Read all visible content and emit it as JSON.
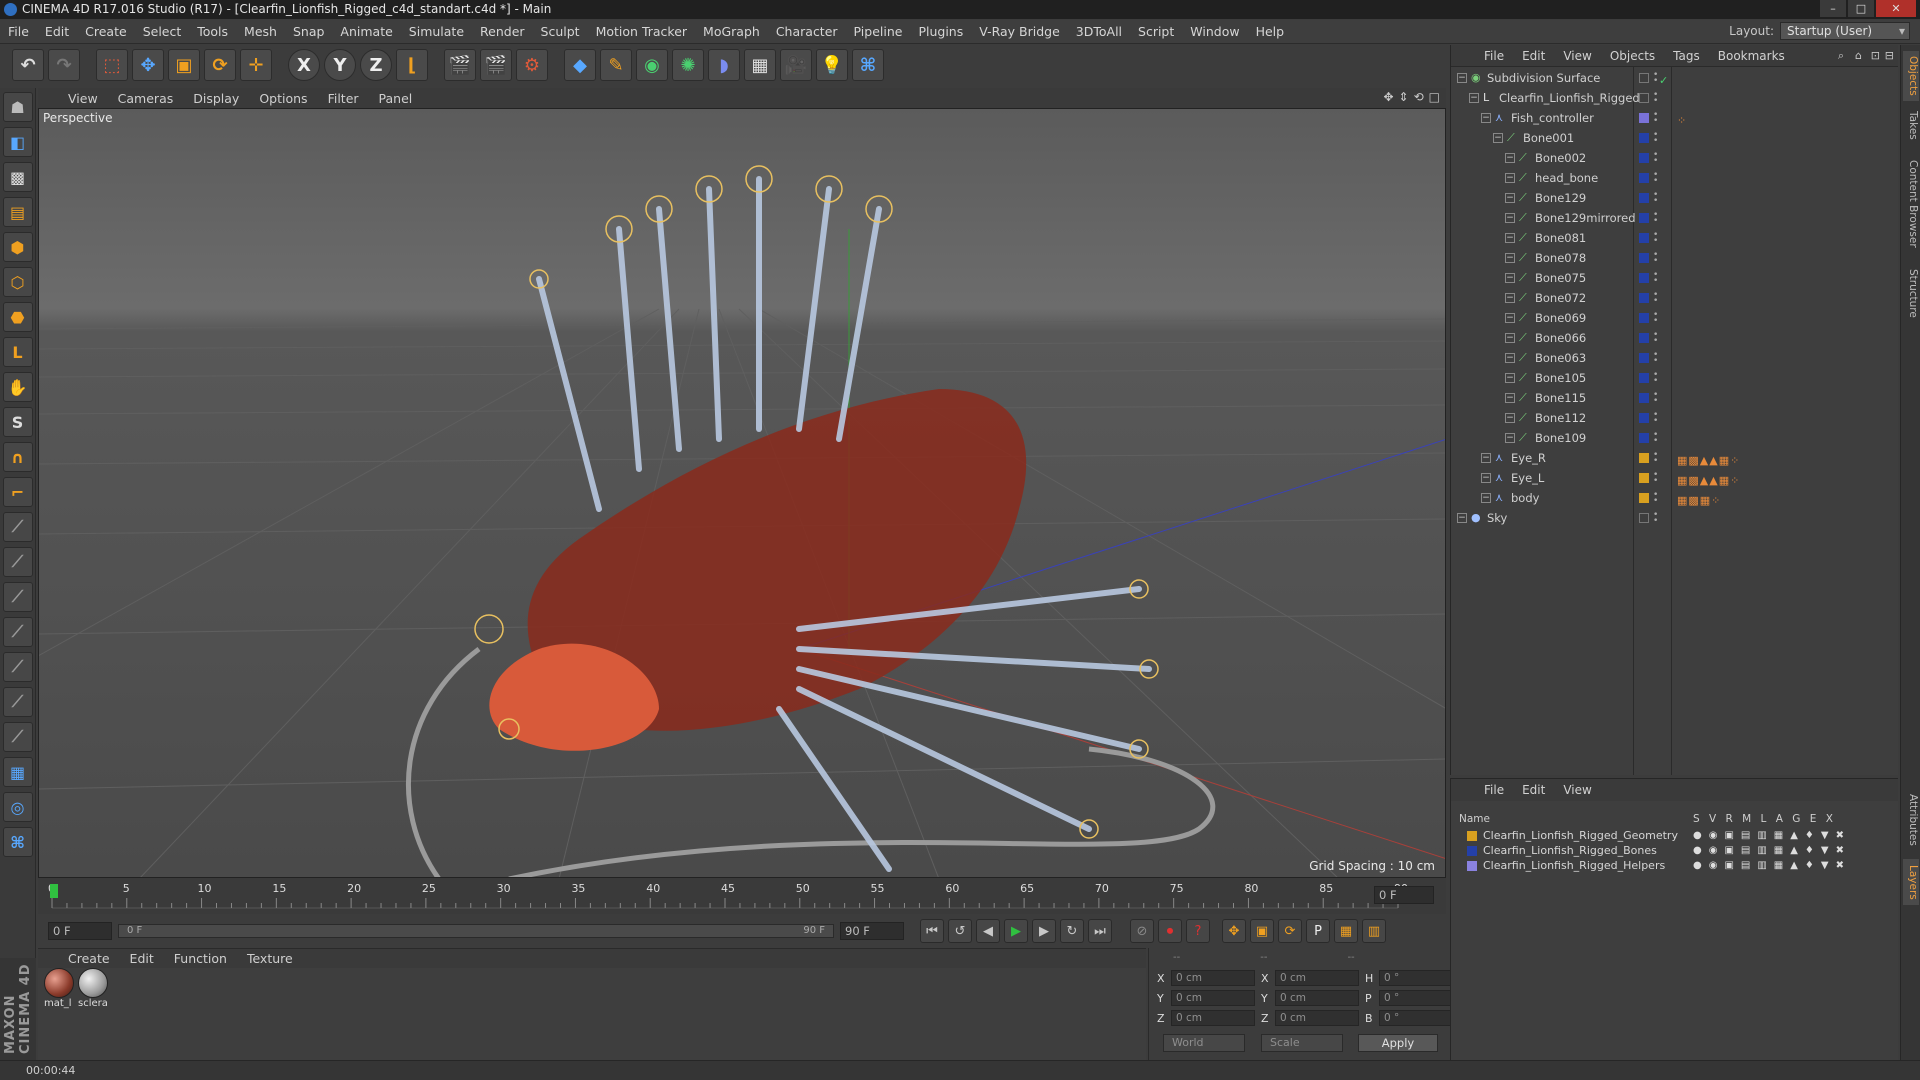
{
  "window": {
    "title": "CINEMA 4D R17.016 Studio (R17) - [Clearfin_Lionfish_Rigged_c4d_standart.c4d *] - Main"
  },
  "menu": [
    "File",
    "Edit",
    "Create",
    "Select",
    "Tools",
    "Mesh",
    "Snap",
    "Animate",
    "Simulate",
    "Render",
    "Sculpt",
    "Motion Tracker",
    "MoGraph",
    "Character",
    "Pipeline",
    "Plugins",
    "V-Ray Bridge",
    "3DToAll",
    "Script",
    "Window",
    "Help"
  ],
  "layout": {
    "label": "Layout:",
    "value": "Startup (User)"
  },
  "toolbar": {
    "x_label": "X",
    "y_label": "Y",
    "z_label": "Z"
  },
  "viewport": {
    "menu": [
      "View",
      "Cameras",
      "Display",
      "Options",
      "Filter",
      "Panel"
    ],
    "label": "Perspective",
    "grid_spacing": "Grid Spacing : 10 cm"
  },
  "timeline": {
    "ticks": [
      "0",
      "5",
      "10",
      "15",
      "20",
      "25",
      "30",
      "35",
      "40",
      "45",
      "50",
      "55",
      "60",
      "65",
      "70",
      "75",
      "80",
      "85",
      "90"
    ],
    "current_frame": "0 F",
    "start_field": "0 F",
    "range_start": "0 F",
    "range_end": "90 F",
    "end_field": "90 F"
  },
  "material": {
    "menu": [
      "Create",
      "Edit",
      "Function",
      "Texture"
    ],
    "items": [
      {
        "label": "mat_l"
      },
      {
        "label": "sclera"
      }
    ]
  },
  "coords": {
    "headers": [
      "--",
      "--",
      "--"
    ],
    "rows": [
      {
        "a": "X",
        "av": "0 cm",
        "b": "X",
        "bv": "0 cm",
        "c": "H",
        "cv": "0 °"
      },
      {
        "a": "Y",
        "av": "0 cm",
        "b": "Y",
        "bv": "0 cm",
        "c": "P",
        "cv": "0 °"
      },
      {
        "a": "Z",
        "av": "0 cm",
        "b": "Z",
        "bv": "0 cm",
        "c": "B",
        "cv": "0 °"
      }
    ],
    "world": "World",
    "scale": "Scale",
    "apply": "Apply"
  },
  "brand": "MAXON CINEMA 4D",
  "status": {
    "time": "00:00:44"
  },
  "objects": {
    "menu": [
      "File",
      "Edit",
      "View",
      "Objects",
      "Tags",
      "Bookmarks"
    ],
    "tree": [
      {
        "name": "Subdivision Surface",
        "depth": 0,
        "color": "#000000",
        "icon": "subdivision-icon"
      },
      {
        "name": "Clearfin_Lionfish_Rigged",
        "depth": 1,
        "color": "#000000",
        "icon": "null-icon"
      },
      {
        "name": "Fish_controller",
        "depth": 2,
        "color": "#7a72d8",
        "icon": "joint-icon"
      },
      {
        "name": "Bone001",
        "depth": 3,
        "color": "#2440a8",
        "icon": "bone-icon"
      },
      {
        "name": "Bone002",
        "depth": 4,
        "color": "#2440a8",
        "icon": "bone-icon"
      },
      {
        "name": "head_bone",
        "depth": 4,
        "color": "#2440a8",
        "icon": "bone-icon"
      },
      {
        "name": "Bone129",
        "depth": 4,
        "color": "#2440a8",
        "icon": "bone-icon"
      },
      {
        "name": "Bone129mirrored",
        "depth": 4,
        "color": "#2440a8",
        "icon": "bone-icon"
      },
      {
        "name": "Bone081",
        "depth": 4,
        "color": "#2440a8",
        "icon": "bone-icon"
      },
      {
        "name": "Bone078",
        "depth": 4,
        "color": "#2440a8",
        "icon": "bone-icon"
      },
      {
        "name": "Bone075",
        "depth": 4,
        "color": "#2440a8",
        "icon": "bone-icon"
      },
      {
        "name": "Bone072",
        "depth": 4,
        "color": "#2440a8",
        "icon": "bone-icon"
      },
      {
        "name": "Bone069",
        "depth": 4,
        "color": "#2440a8",
        "icon": "bone-icon"
      },
      {
        "name": "Bone066",
        "depth": 4,
        "color": "#2440a8",
        "icon": "bone-icon"
      },
      {
        "name": "Bone063",
        "depth": 4,
        "color": "#2440a8",
        "icon": "bone-icon"
      },
      {
        "name": "Bone105",
        "depth": 4,
        "color": "#2440a8",
        "icon": "bone-icon"
      },
      {
        "name": "Bone115",
        "depth": 4,
        "color": "#2440a8",
        "icon": "bone-icon"
      },
      {
        "name": "Bone112",
        "depth": 4,
        "color": "#2440a8",
        "icon": "bone-icon"
      },
      {
        "name": "Bone109",
        "depth": 4,
        "color": "#2440a8",
        "icon": "bone-icon"
      },
      {
        "name": "Eye_R",
        "depth": 2,
        "color": "#d8a020",
        "icon": "joint-icon"
      },
      {
        "name": "Eye_L",
        "depth": 2,
        "color": "#d8a020",
        "icon": "joint-icon"
      },
      {
        "name": "body",
        "depth": 2,
        "color": "#d8a020",
        "icon": "joint-icon"
      },
      {
        "name": "Sky",
        "depth": 0,
        "color": "#000000",
        "icon": "sky-icon"
      }
    ]
  },
  "layers": {
    "menu": [
      "File",
      "Edit",
      "View"
    ],
    "header_name": "Name",
    "header_flags": "S V R M L A G E X",
    "rows": [
      {
        "name": "Clearfin_Lionfish_Rigged_Geometry",
        "color": "#d8a020"
      },
      {
        "name": "Clearfin_Lionfish_Rigged_Bones",
        "color": "#2440a8"
      },
      {
        "name": "Clearfin_Lionfish_Rigged_Helpers",
        "color": "#8a82e0"
      }
    ]
  },
  "right_tabs": [
    "Objects",
    "Takes",
    "Content Browser",
    "Structure",
    "Attributes",
    "Layers"
  ]
}
